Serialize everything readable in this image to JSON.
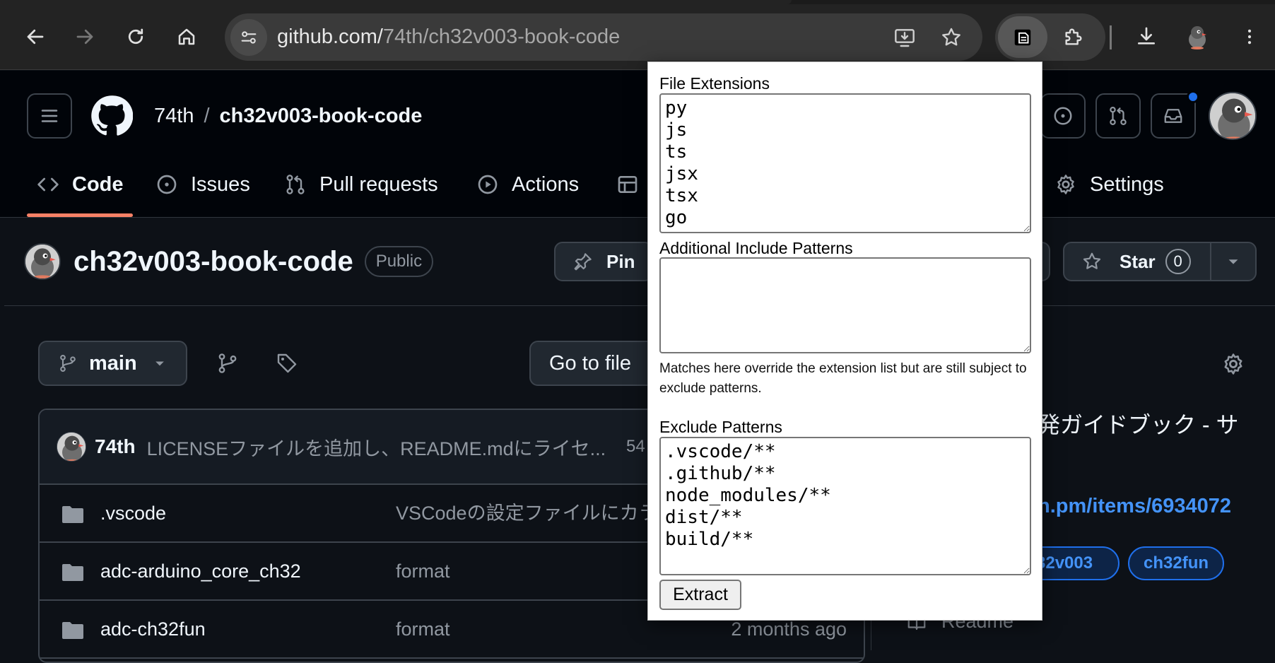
{
  "browser": {
    "url_host": "github.com/",
    "url_path": "74th/ch32v003-book-code",
    "icons": [
      "back-icon",
      "forward-icon",
      "reload-icon",
      "home-icon",
      "site-info-icon",
      "install-app-icon",
      "bookmark-star-icon",
      "extension-icon",
      "puzzle-extensions-icon",
      "download-icon",
      "profile-avatar",
      "more-menu-icon"
    ]
  },
  "github": {
    "owner": "74th",
    "crumb_sep": "/",
    "repo": "ch32v003-book-code",
    "nav_tabs": [
      {
        "label": "Code",
        "icon": "code-icon"
      },
      {
        "label": "Issues",
        "icon": "issue-icon"
      },
      {
        "label": "Pull requests",
        "icon": "pull-request-icon"
      },
      {
        "label": "Actions",
        "icon": "actions-play-icon"
      },
      {
        "label": "Settings",
        "icon": "gear-icon"
      }
    ],
    "repo_title": "ch32v003-book-code",
    "visibility": "Public",
    "pin_label": "Pin",
    "star_label": "Star",
    "star_count": "0",
    "branch": "main",
    "go_to_file": "Go to file",
    "commit": {
      "author": "74th",
      "message": "LICENSEファイルを追加し、README.mdにライセ...",
      "hash_partial": "54"
    },
    "files": [
      {
        "name": ".vscode",
        "message": "VSCodeの設定ファイルにカラ",
        "date": ""
      },
      {
        "name": "adc-arduino_core_ch32",
        "message": "format",
        "date": ""
      },
      {
        "name": "adc-ch32fun",
        "message": "format",
        "date": "2 months ago"
      }
    ],
    "about_partial": "発ガイドブック - サ",
    "about_link_partial": "n.pm/items/6934072",
    "topics": [
      "32v003",
      "ch32fun"
    ],
    "readme_label": "Readme"
  },
  "popup": {
    "file_ext_label": "File Extensions",
    "file_ext_value": "py\njs\nts\njsx\ntsx\ngo",
    "include_label": "Additional Include Patterns",
    "include_value": "",
    "note": "Matches here override the extension list but are still subject to exclude patterns.",
    "exclude_label": "Exclude Patterns",
    "exclude_value": ".vscode/**\n.github/**\nnode_modules/**\ndist/**\nbuild/**",
    "extract_label": "Extract"
  },
  "colors": {
    "bg": "#0d1117",
    "header_bg": "#010409",
    "accent_underline": "#f78166",
    "link": "#4493f8",
    "notification_dot": "#1f6feb"
  }
}
